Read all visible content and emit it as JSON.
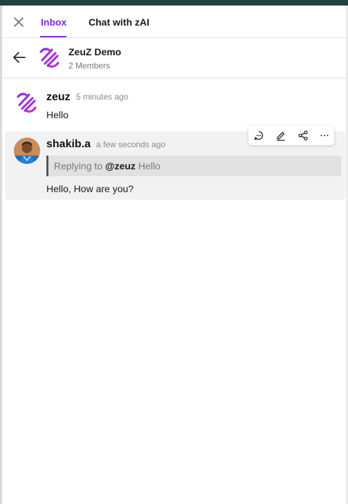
{
  "tabs": {
    "inbox": "Inbox",
    "chat_zai": "Chat with zAI"
  },
  "group": {
    "name": "ZeuZ Demo",
    "members": "2 Members"
  },
  "messages": [
    {
      "author": "zeuz",
      "time": "5 minutes ago",
      "text": "Hello"
    },
    {
      "author": "shakib.a",
      "time": "a few seconds ago",
      "reply_prefix": "Replying to",
      "reply_mention": "@zeuz",
      "reply_text": "Hello",
      "text": "Hello, How are you?"
    }
  ],
  "colors": {
    "accent": "#7b2bd9",
    "logo_gradient_start": "#6a2de0",
    "logo_gradient_end": "#e03ac8"
  },
  "icons": [
    "close-icon",
    "back-arrow-icon",
    "reply-icon",
    "edit-icon",
    "share-icon",
    "more-icon"
  ]
}
